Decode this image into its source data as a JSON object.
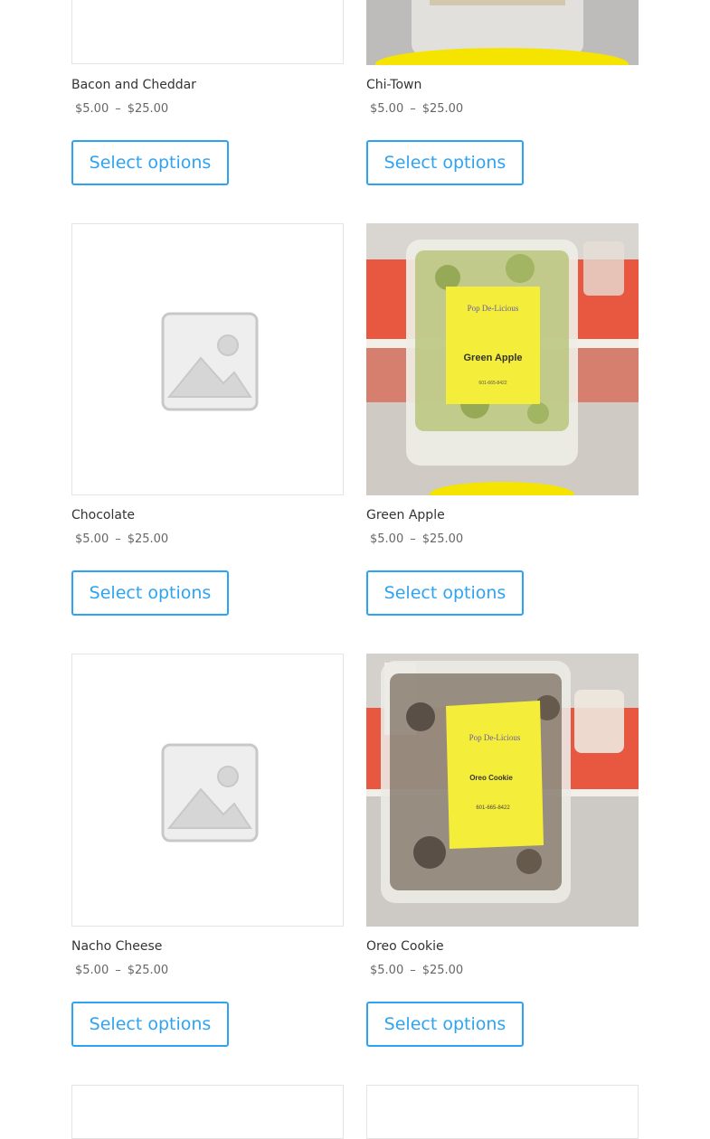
{
  "products": [
    {
      "title": "Bacon and Cheddar",
      "price_min": "$5.00",
      "price_sep": "–",
      "price_max": "$25.00",
      "button": "Select options",
      "image": "placeholder-image-icon"
    },
    {
      "title": "Chi-Town",
      "price_min": "$5.00",
      "price_sep": "–",
      "price_max": "$25.00",
      "button": "Select options",
      "image": "product-photo"
    },
    {
      "title": "Chocolate",
      "price_min": "$5.00",
      "price_sep": "–",
      "price_max": "$25.00",
      "button": "Select options",
      "image": "placeholder-image-icon"
    },
    {
      "title": "Green Apple",
      "price_min": "$5.00",
      "price_sep": "–",
      "price_max": "$25.00",
      "button": "Select options",
      "image": "product-photo",
      "label_text": "Green Apple",
      "brand_text": "Pop De-Licious",
      "phone_text": "601-665-8422"
    },
    {
      "title": "Nacho Cheese",
      "price_min": "$5.00",
      "price_sep": "–",
      "price_max": "$25.00",
      "button": "Select options",
      "image": "placeholder-image-icon"
    },
    {
      "title": "Oreo Cookie",
      "price_min": "$5.00",
      "price_sep": "–",
      "price_max": "$25.00",
      "button": "Select options",
      "image": "product-photo",
      "label_text": "Oreo Cookie",
      "brand_text": "Pop De-Licious",
      "phone_text": "601-665-8422"
    }
  ],
  "colors": {
    "accent": "#2ea3f2",
    "title_text": "#333333",
    "price_text": "#666666",
    "label_yellow": "#f4ee3a",
    "wall_red": "#e8503a"
  }
}
